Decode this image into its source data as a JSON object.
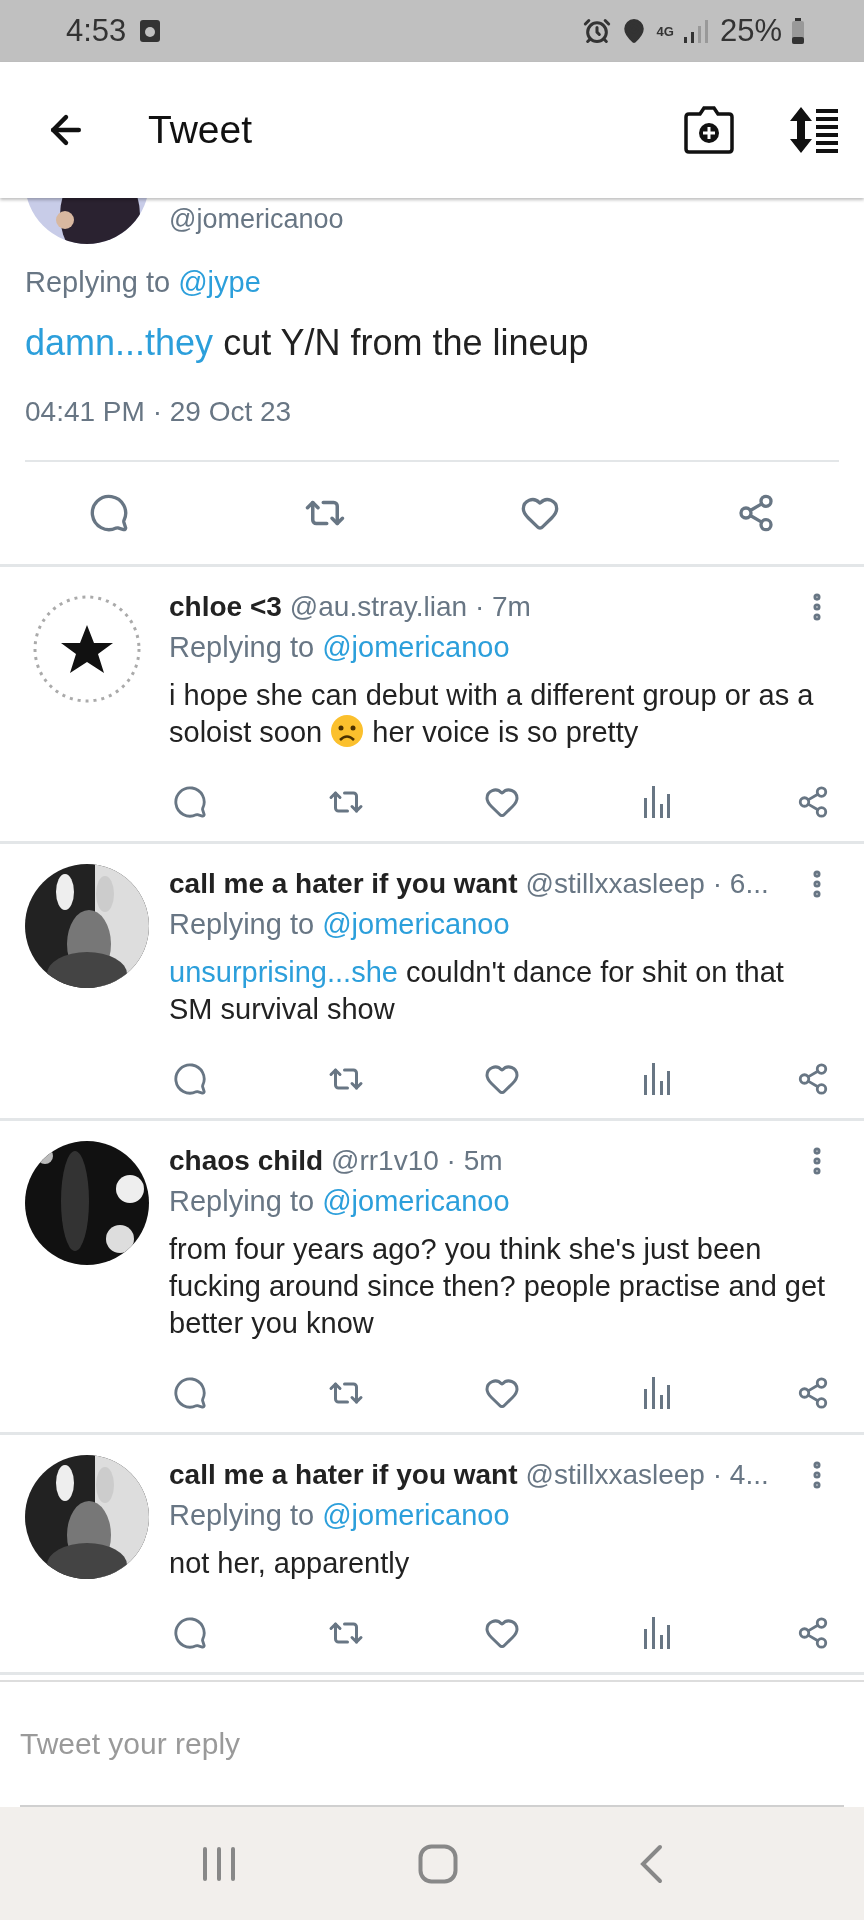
{
  "status_bar": {
    "time": "4:53",
    "network": "4G",
    "battery": "25%"
  },
  "header": {
    "title": "Tweet"
  },
  "tweet": {
    "handle": "@jomericanoo",
    "replying_label": "Replying to",
    "replying_to": "@jype",
    "body": [
      {
        "kind": "link",
        "text": "damn...they"
      },
      {
        "kind": "text",
        "text": "cut Y/N from the lineup"
      }
    ],
    "timestamp": "04:41 PM · 29 Oct 23"
  },
  "replies": [
    {
      "name": "chloe <3",
      "meta": "@au.stray.lian · 7m",
      "replying_label": "Replying to",
      "replying_to": "@jomericanoo",
      "body": [
        {
          "kind": "text",
          "text": "i hope she can debut with a different group or as a soloist soon"
        },
        {
          "kind": "emoji"
        },
        {
          "kind": "text",
          "text": "her voice is so pretty"
        }
      ]
    },
    {
      "name": "call me a hater if you want",
      "meta": "@stillxxasleep · 6...",
      "replying_label": "Replying to",
      "replying_to": "@jomericanoo",
      "body": [
        {
          "kind": "link",
          "text": "unsurprising...she"
        },
        {
          "kind": "text",
          "text": "couldn't dance for shit on that SM survival show"
        }
      ]
    },
    {
      "name": "chaos child",
      "meta": "@rr1v10 · 5m",
      "replying_label": "Replying to",
      "replying_to": "@jomericanoo",
      "body": [
        {
          "kind": "text",
          "text": "from four years ago? you think she's just been fucking around since then? people practise and get better you know"
        }
      ]
    },
    {
      "name": "call me a hater if you want",
      "meta": "@stillxxasleep · 4...",
      "replying_label": "Replying to",
      "replying_to": "@jomericanoo",
      "body": [
        {
          "kind": "text",
          "text": "not her, apparently"
        }
      ]
    }
  ],
  "reply_box": {
    "placeholder": "Tweet your reply"
  }
}
